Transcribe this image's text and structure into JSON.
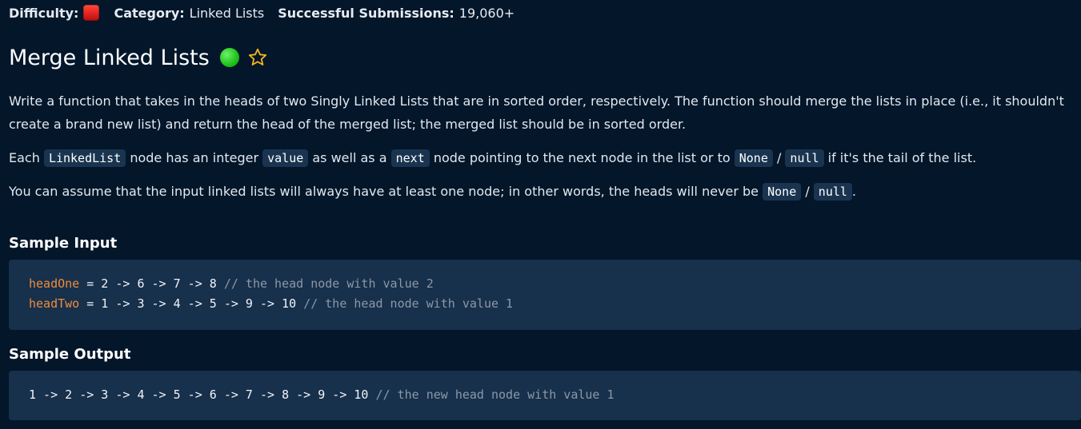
{
  "meta": {
    "difficulty_label": "Difficulty:",
    "difficulty_color": "#e02020",
    "category_label": "Category:",
    "category_value": "Linked Lists",
    "submissions_label": "Successful Submissions:",
    "submissions_value": "19,060+"
  },
  "problem": {
    "title": "Merge Linked Lists",
    "status_color": "#22c51e",
    "star_icon": "star-outline-icon",
    "star_color": "#f2b51c"
  },
  "description": {
    "p1_line1": "Write a function that takes in the heads of two Singly Linked Lists that are in sorted order, respectively. The function should merge the lists in place (i.e., it shouldn't",
    "p1_line2": "create a brand new list) and return the head of the merged list; the merged list should be in sorted order.",
    "p2_t1": "Each ",
    "p2_c1": "LinkedList",
    "p2_t2": " node has an integer ",
    "p2_c2": "value",
    "p2_t3": " as well as a ",
    "p2_c3": "next",
    "p2_t4": " node pointing to the next node in the list or to ",
    "p2_c4": "None",
    "p2_t5": " / ",
    "p2_c5": "null",
    "p2_t6": " if it's the tail of the list.",
    "p3_t1": "You can assume that the input linked lists will always have at least one node; in other words, the heads will never be ",
    "p3_c1": "None",
    "p3_t2": " / ",
    "p3_c2": "null",
    "p3_t3": "."
  },
  "sample_input": {
    "heading": "Sample Input",
    "line1_var": "headOne",
    "line1_expr": " = 2 -> 6 -> 7 -> 8 ",
    "line1_comment": "// the head node with value 2",
    "line2_var": "headTwo",
    "line2_expr": " = 1 -> 3 -> 4 -> 5 -> 9 -> 10 ",
    "line2_comment": "// the head node with value 1"
  },
  "sample_output": {
    "heading": "Sample Output",
    "line1_expr": "1 -> 2 -> 3 -> 4 -> 5 -> 6 -> 7 -> 8 -> 9 -> 10 ",
    "line1_comment": "// the new head node with value 1"
  }
}
